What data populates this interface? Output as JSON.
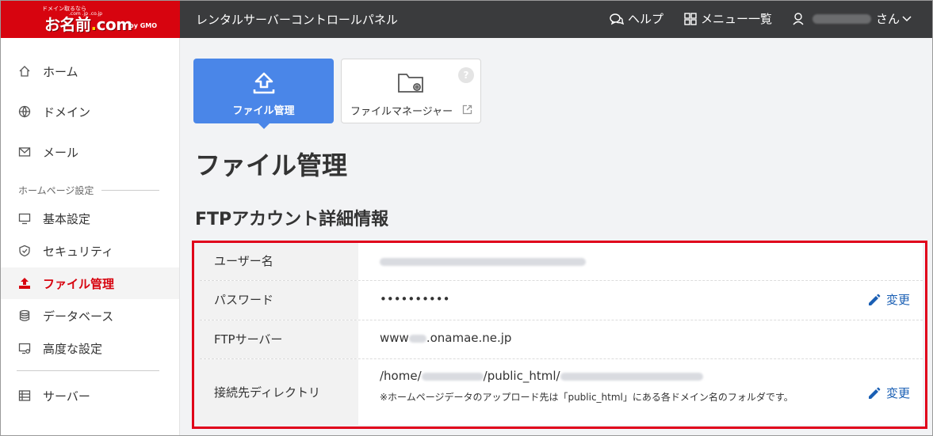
{
  "header": {
    "logo_tagline": "ドメイン取るなら",
    "logo_tld": ".com .jp .co.jp",
    "logo_main": "お名前",
    "logo_dot": ".",
    "logo_com": "com",
    "logo_gmo": "by GMO",
    "app_title": "レンタルサーバーコントロールパネル",
    "help_label": "ヘルプ",
    "menu_label": "メニュー一覧",
    "user_suffix": "さん"
  },
  "sidebar": {
    "items_top": [
      {
        "label": "ホーム"
      },
      {
        "label": "ドメイン"
      },
      {
        "label": "メール"
      }
    ],
    "section_label": "ホームページ設定",
    "items_section": [
      {
        "label": "基本設定"
      },
      {
        "label": "セキュリティ"
      },
      {
        "label": "ファイル管理"
      },
      {
        "label": "データベース"
      },
      {
        "label": "高度な設定"
      }
    ],
    "items_bottom": [
      {
        "label": "サーバー"
      }
    ],
    "active": "ファイル管理"
  },
  "tabs": [
    {
      "label": "ファイル管理",
      "active": true
    },
    {
      "label": "ファイルマネージャー",
      "active": false,
      "help": "?"
    }
  ],
  "page_title": "ファイル管理",
  "section_title": "FTPアカウント詳細情報",
  "ftp": {
    "username_label": "ユーザー名",
    "password_label": "パスワード",
    "password_value": "••••••••••",
    "server_label": "FTPサーバー",
    "server_prefix": "www",
    "server_suffix": ".onamae.ne.jp",
    "dir_label": "接続先ディレクトリ",
    "dir_prefix": "/home/",
    "dir_middle": "/public_html/",
    "dir_note": "※ホームページデータのアップロード先は「public_html」にある各ドメイン名のフォルダです。",
    "edit_label": "変更"
  },
  "colors": {
    "brand_red": "#d7040f",
    "header_bg": "#3a3b3d",
    "tab_active": "#4a86e8",
    "link_blue": "#1a5fb4",
    "highlight": "#e0001b"
  }
}
